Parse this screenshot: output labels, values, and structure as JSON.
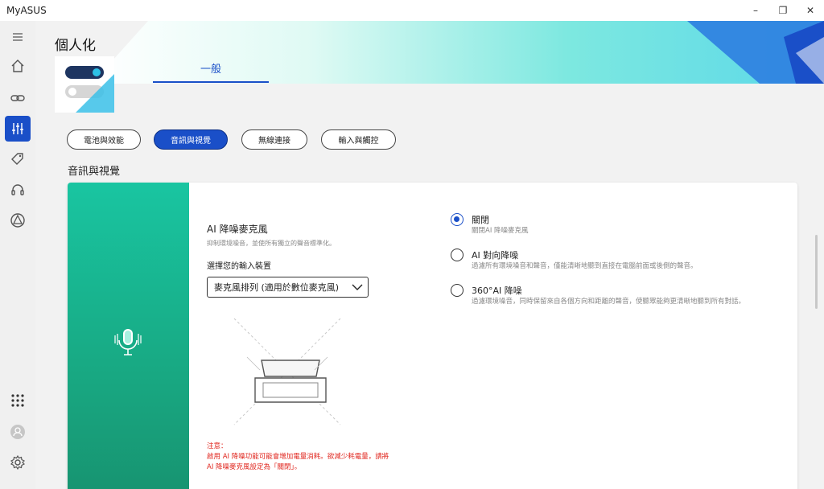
{
  "app": {
    "title": "MyASUS"
  },
  "window_controls": {
    "minimize": "–",
    "maximize": "❐",
    "close": "✕"
  },
  "sidebar": {
    "items": [
      {
        "name": "menu-icon",
        "active": false
      },
      {
        "name": "home-icon",
        "active": false
      },
      {
        "name": "link-icon",
        "active": false
      },
      {
        "name": "customization-icon",
        "active": true
      },
      {
        "name": "tag-icon",
        "active": false
      },
      {
        "name": "headset-icon",
        "active": false
      },
      {
        "name": "triangle-logo-icon",
        "active": false
      },
      {
        "name": "apps-grid-icon",
        "active": false
      },
      {
        "name": "account-icon",
        "active": false
      },
      {
        "name": "settings-icon",
        "active": false
      }
    ]
  },
  "header": {
    "title": "個人化",
    "tab": "一般"
  },
  "categories": [
    {
      "label": "電池與效能",
      "active": false
    },
    {
      "label": "音訊與視覺",
      "active": true
    },
    {
      "label": "無線連接",
      "active": false
    },
    {
      "label": "輸入與觸控",
      "active": false
    }
  ],
  "section": {
    "title": "音訊與視覺"
  },
  "feature": {
    "title": "AI 降噪麥克風",
    "description": "抑制環境噪音，並使所有獨立的聲音標準化。",
    "select_label": "選擇您的輸入裝置",
    "select_value": "麥克風排列 (適用於數位麥克風)"
  },
  "note": {
    "heading": "注意：",
    "line1": "啟用 AI 降噪功能可能會增加電量消耗。欲減少耗電量，請將",
    "line2": "AI 降噪麥克風設定為「關閉」。"
  },
  "options": [
    {
      "title": "關閉",
      "description": "關閉AI 降噪麥克風",
      "checked": true
    },
    {
      "title": "AI 對向降噪",
      "description": "過濾所有環境噪音和聲音，僅能清晰地聽到直接在電腦前面或後側的聲音。",
      "checked": false
    },
    {
      "title": "360°AI 降噪",
      "description": "過濾環境噪音，同時保留來自各個方向和距離的聲音，使聽眾能夠更清晰地聽到所有對話。",
      "checked": false
    }
  ],
  "colors": {
    "accent": "#1a4fc8",
    "strip": "#18a882",
    "warning": "#e0261e"
  }
}
